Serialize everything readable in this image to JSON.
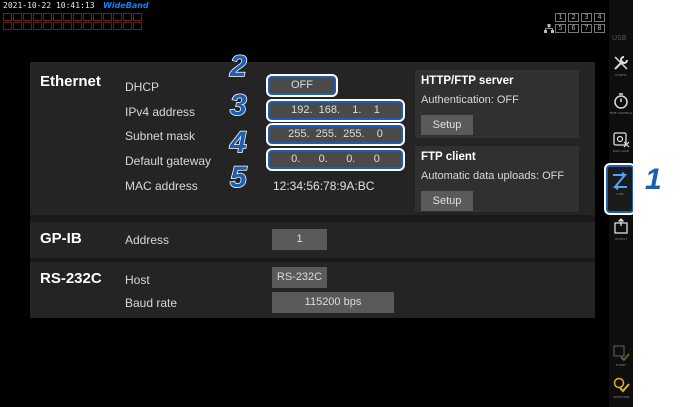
{
  "status": {
    "timestamp": "2021-10-22 10:41:13",
    "mode_badge": "WideBand",
    "channel_grid": [
      "1",
      "2",
      "3",
      "4",
      "5",
      "6",
      "7",
      "8"
    ],
    "usb_label": "USB"
  },
  "ethernet": {
    "title": "Ethernet",
    "rows": [
      {
        "label": "DHCP",
        "value": "OFF"
      },
      {
        "label": "IPv4 address",
        "value": "192.  168.    1.    1"
      },
      {
        "label": "Subnet mask",
        "value": "255.  255.  255.    0"
      },
      {
        "label": "Default gateway",
        "value": "0.      0.      0.      0"
      },
      {
        "label": "MAC address",
        "value": "12:34:56:78:9A:BC"
      }
    ],
    "http_ftp_server": {
      "title": "HTTP/FTP server",
      "text": "Authentication: OFF",
      "button": "Setup"
    },
    "ftp_client": {
      "title": "FTP client",
      "text": "Automatic data uploads: OFF",
      "button": "Setup"
    }
  },
  "gpib": {
    "title": "GP-IB",
    "label": "Address",
    "value": "1"
  },
  "rs232c": {
    "title": "RS-232C",
    "host_label": "Host",
    "host_value": "RS-232C",
    "baud_label": "Baud rate",
    "baud_value": "115200 bps"
  },
  "callouts": [
    "1",
    "2",
    "3",
    "4",
    "5"
  ],
  "sidebar": [
    {
      "icon": "wrench-screwdriver-icon",
      "caption": "CONFIG"
    },
    {
      "icon": "timer-icon",
      "caption": "TIME CONTROL"
    },
    {
      "icon": "disk-icon",
      "caption": "DATA SAVE"
    },
    {
      "icon": "com-icon",
      "caption": "COM"
    },
    {
      "icon": "output-icon",
      "caption": "OUTPUT"
    },
    {
      "icon": "check-icon",
      "caption": "EVENT"
    },
    {
      "icon": "check-active-icon",
      "caption": "SWITCHON"
    }
  ],
  "colors": {
    "accent": "#1a5fb4",
    "badge": "#0a84ff",
    "panel": "#242424",
    "field": "#5a5a5a"
  }
}
